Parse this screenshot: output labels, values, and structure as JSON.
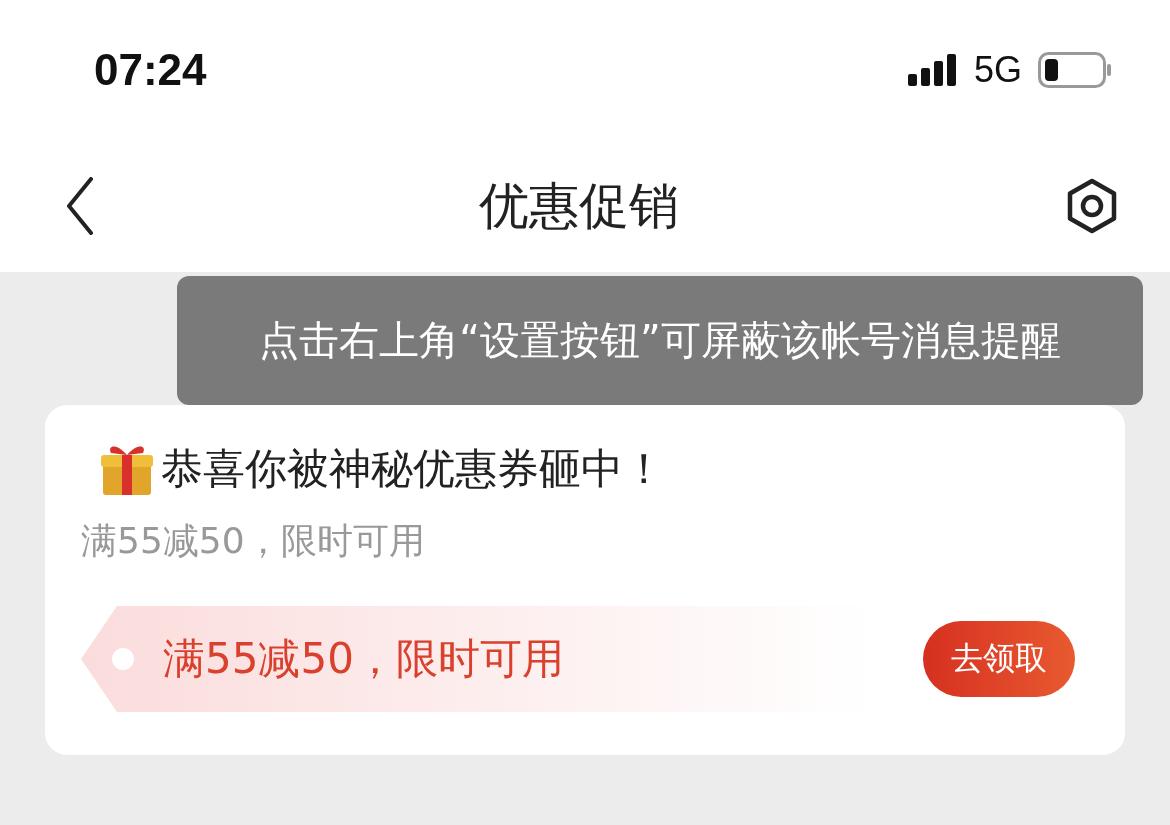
{
  "status_bar": {
    "time": "07:24",
    "network": "5G"
  },
  "nav": {
    "title": "优惠促销"
  },
  "tooltip": {
    "text": "点击右上角“设置按钮”可屏蔽该帐号消息提醒"
  },
  "card": {
    "title": "恭喜你被神秘优惠券砸中！",
    "subtitle": "满55减50，限时可用",
    "coupon": {
      "text": "满55减50，限时可用",
      "button": "去领取"
    }
  }
}
